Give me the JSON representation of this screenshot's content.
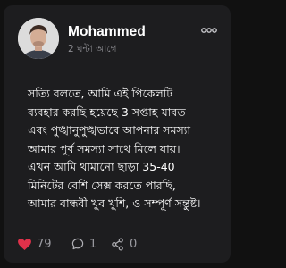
{
  "post": {
    "author_name": "Mohammed",
    "time_ago": "2 ঘন্টা আগে",
    "body_lines": [
      "সত্যি বলতে, আমি এই পিকেলটি",
      "ব্যবহার করছি হয়েছে 3 সপ্তাহ যাবত",
      "এবং পুঙ্খানুপুঙ্খভাবে আপনার সমস্যা",
      "আমার পূর্ব সমস্যা সাথে মিলে যায়।",
      "এখন আমি থামানো ছাড়া 35-40",
      "মিনিটের বেশি সেক্স করতে পারছি,",
      "আমার বান্ধবী খুব খুশি, ও সম্পূর্ণ সন্তুষ্ট।"
    ]
  },
  "actions": {
    "likes": "79",
    "comments": "1",
    "shares": "0"
  },
  "icons": {
    "like": "heart-icon",
    "comment": "comment-bubble-icon",
    "share": "share-icon",
    "more": "more-dots-icon"
  },
  "colors": {
    "background": "#111111",
    "card": "#1d1d1f",
    "like_heart": "#e0314a",
    "muted": "#9a9aa0"
  }
}
